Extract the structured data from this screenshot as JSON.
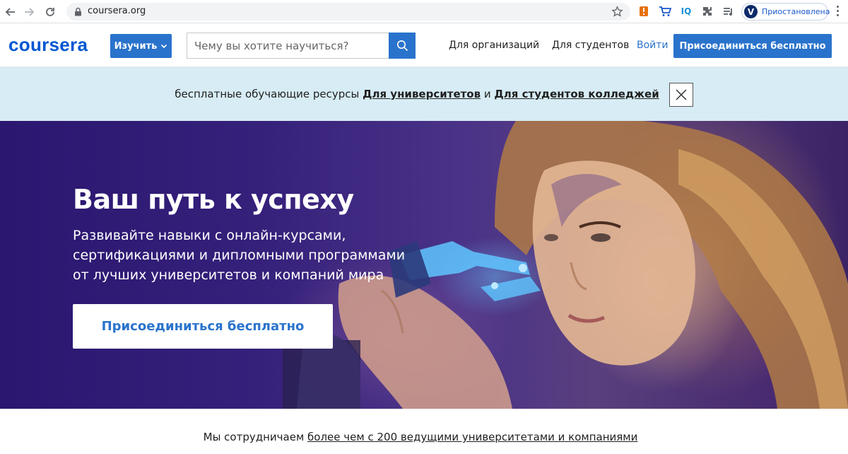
{
  "browser": {
    "url": "coursera.org",
    "profile_label": "Приостановлена",
    "profile_initial": "V",
    "extensions": [
      {
        "name": "flag-extension-icon",
        "glyph": "!",
        "color": "#e8710a"
      },
      {
        "name": "cart-extension-icon",
        "glyph": "",
        "color": "#1a57c9"
      },
      {
        "name": "iq-extension-icon",
        "glyph": "IQ",
        "color": "#1a8fd6"
      },
      {
        "name": "puzzle-icon",
        "glyph": "",
        "color": "#5f6368"
      },
      {
        "name": "playlist-icon",
        "glyph": "",
        "color": "#5f6368"
      }
    ]
  },
  "header": {
    "logo": "coursera",
    "learn_label": "Изучить",
    "search_placeholder": "Чему вы хотите научиться?",
    "links": [
      "Для организаций",
      "Для студентов"
    ],
    "signin_label": "Войти",
    "join_label": "Присоединиться бесплатно"
  },
  "banner": {
    "prefix": "бесплатные обучающие ресурсы",
    "link1": "Для университетов",
    "connector": "и",
    "link2": "Для студентов колледжей"
  },
  "hero": {
    "title": "Ваш путь к успеху",
    "subtitle": "Развивайте навыки с онлайн-курсами, сертификациями и дипломными программами от лучших университетов и компаний мира",
    "cta_label": "Присоединиться бесплатно"
  },
  "partners": {
    "prefix": "Мы сотрудничаем",
    "link": "более чем с 200 ведущими университетами и компаниями"
  },
  "colors": {
    "brand_blue": "#0056d2",
    "button_blue": "#2a73cc",
    "banner_bg": "#d7ecf4",
    "hero_bg": "#2b1670"
  }
}
